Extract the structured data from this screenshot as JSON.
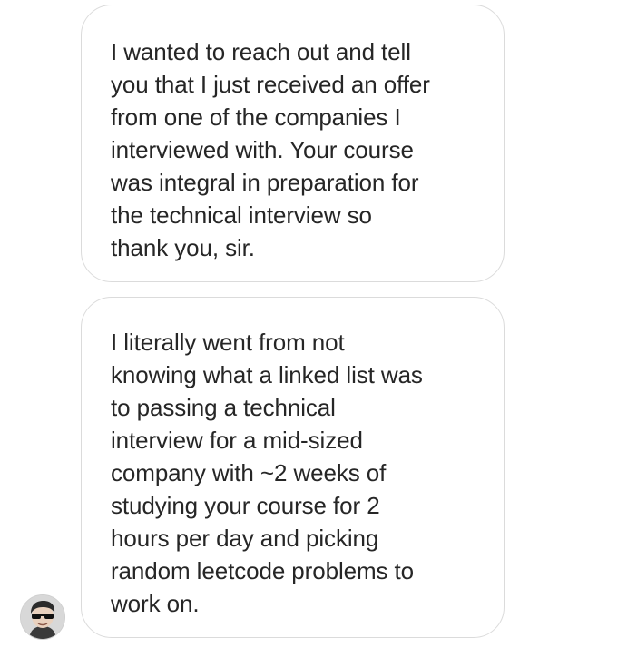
{
  "messages": [
    {
      "text": "I wanted to reach out and tell\nyou that I just received an offer\nfrom one of the companies I\ninterviewed with. Your course\nwas integral in preparation for\nthe technical interview so\nthank you, sir."
    },
    {
      "text": "I literally went from not\nknowing what a linked list was\nto passing a technical\ninterview for a mid-sized\ncompany with ~2 weeks of\nstudying your course for 2\nhours per day and picking\nrandom leetcode problems to\nwork on."
    }
  ],
  "sender": {
    "avatar_icon": "user-avatar-with-sunglasses-icon"
  }
}
